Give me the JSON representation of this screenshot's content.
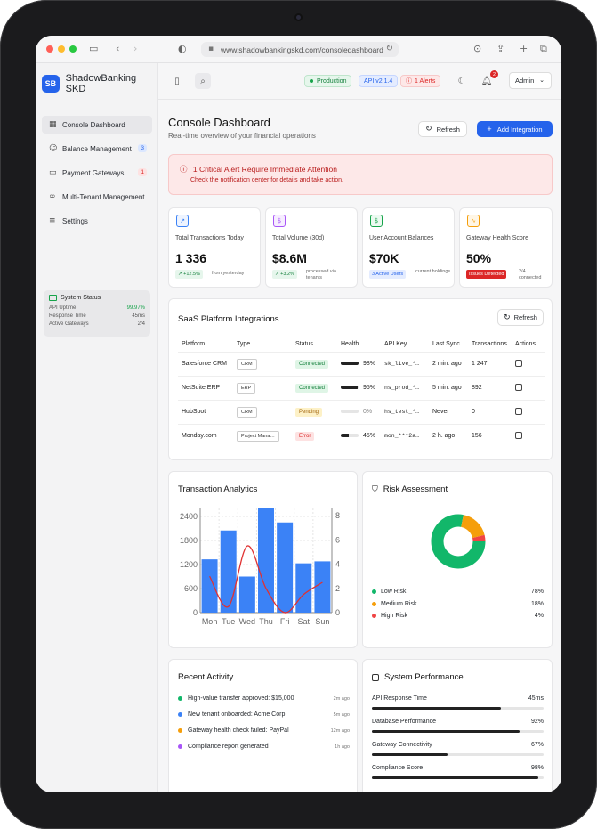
{
  "browser": {
    "url": "www.shadowbankingskd.com/consoledashboard"
  },
  "app": {
    "logo_text": "SB",
    "name": "ShadowBanking SKD"
  },
  "sidebar": {
    "items": [
      {
        "label": "Console Dashboard",
        "icon": "grid-icon",
        "badge": ""
      },
      {
        "label": "Balance Management",
        "icon": "users-icon",
        "badge": "3"
      },
      {
        "label": "Payment Gateways",
        "icon": "card-icon",
        "badge": "1"
      },
      {
        "label": "Multi-Tenant Management",
        "icon": "link-icon",
        "badge": ""
      },
      {
        "label": "Settings",
        "icon": "sliders-icon",
        "badge": ""
      }
    ],
    "system_status": {
      "title": "System Status",
      "rows": [
        {
          "label": "API Uptime",
          "value": "99.97%"
        },
        {
          "label": "Response Time",
          "value": "45ms"
        },
        {
          "label": "Active Gateways",
          "value": "2/4"
        }
      ]
    }
  },
  "header": {
    "env": "Production",
    "api_version": "API v2.1.4",
    "alerts": "1 Alerts",
    "notification_count": "2",
    "user": "Admin"
  },
  "page": {
    "title": "Console Dashboard",
    "subtitle": "Real-time overview of your financial operations",
    "refresh_label": "Refresh",
    "add_label": "Add Integration"
  },
  "alert": {
    "title": "1 Critical Alert Require Immediate Attention",
    "detail": "Check the notification center for details and take action."
  },
  "stats": [
    {
      "label": "Total Transactions Today",
      "value": "1 336",
      "badge": "+12.5%",
      "note": "from yesterday"
    },
    {
      "label": "Total Volume (30d)",
      "value": "$8.6M",
      "badge": "+3.2%",
      "note": "processed via tenants"
    },
    {
      "label": "User Account Balances",
      "value": "$70K",
      "badge": "3 Active Users",
      "note": "current holdings"
    },
    {
      "label": "Gateway Health Score",
      "value": "50%",
      "badge": "Issues Detected",
      "note": "2/4 connected"
    }
  ],
  "integrations": {
    "title": "SaaS Platform Integrations",
    "refresh_label": "Refresh",
    "columns": [
      "Platform",
      "Type",
      "Status",
      "Health",
      "API Key",
      "Last Sync",
      "Transactions",
      "Actions"
    ],
    "rows": [
      {
        "platform": "Salesforce CRM",
        "type": "CRM",
        "status": "Connected",
        "health": 98,
        "health_label": "98%",
        "api_key": "sk_live_*…",
        "last_sync": "2 min. ago",
        "transactions": "1 247"
      },
      {
        "platform": "NetSuite ERP",
        "type": "ERP",
        "status": "Connected",
        "health": 95,
        "health_label": "95%",
        "api_key": "ns_prod_*…",
        "last_sync": "5 min. ago",
        "transactions": "892"
      },
      {
        "platform": "HubSpot",
        "type": "CRM",
        "status": "Pending",
        "health": 0,
        "health_label": "0%",
        "api_key": "hs_test_*…",
        "last_sync": "Never",
        "transactions": "0"
      },
      {
        "platform": "Monday.com",
        "type": "Project Mana…",
        "status": "Error",
        "health": 45,
        "health_label": "45%",
        "api_key": "mon_***2a…",
        "last_sync": "2 h. ago",
        "transactions": "156"
      }
    ]
  },
  "analytics": {
    "title": "Transaction Analytics"
  },
  "chart_data": {
    "type": "bar",
    "categories": [
      "Mon",
      "Tue",
      "Wed",
      "Thu",
      "Fri",
      "Sat",
      "Sun"
    ],
    "series": [
      {
        "values": [
          1330,
          2050,
          900,
          2600,
          2250,
          1230,
          1280
        ],
        "axis": "left",
        "kind": "bar",
        "color": "#3b82f6"
      },
      {
        "values": [
          3,
          0.5,
          5.5,
          2,
          0,
          1.5,
          2.5
        ],
        "axis": "right",
        "kind": "line",
        "color": "#e03131"
      }
    ],
    "ylim": [
      0,
      2600
    ],
    "yticks": [
      0,
      600,
      1200,
      1800,
      2400
    ],
    "y2lim": [
      0,
      8.6
    ],
    "y2ticks": [
      0,
      2,
      4,
      6,
      8
    ],
    "grid": true
  },
  "risk": {
    "title": "Risk Assessment",
    "items": [
      {
        "label": "Low Risk",
        "value": 78,
        "value_label": "78%",
        "color": "#12b76a"
      },
      {
        "label": "Medium Risk",
        "value": 18,
        "value_label": "18%",
        "color": "#f59e0b"
      },
      {
        "label": "High Risk",
        "value": 4,
        "value_label": "4%",
        "color": "#ef4444"
      }
    ]
  },
  "activity": {
    "title": "Recent Activity",
    "items": [
      {
        "text": "High-value transfer approved: $15,000",
        "time": "2m ago",
        "color": "#12b76a"
      },
      {
        "text": "New tenant onboarded: Acme Corp",
        "time": "5m ago",
        "color": "#3b82f6"
      },
      {
        "text": "Gateway health check failed: PayPal",
        "time": "12m ago",
        "color": "#f59e0b"
      },
      {
        "text": "Compliance report generated",
        "time": "1h ago",
        "color": "#a855f7"
      }
    ]
  },
  "performance": {
    "title": "System Performance",
    "items": [
      {
        "label": "API Response Time",
        "value_label": "45ms",
        "fill": 75
      },
      {
        "label": "Database Performance",
        "value_label": "92%",
        "fill": 86
      },
      {
        "label": "Gateway Connectivity",
        "value_label": "67%",
        "fill": 44
      },
      {
        "label": "Compliance Score",
        "value_label": "98%",
        "fill": 97
      }
    ]
  }
}
